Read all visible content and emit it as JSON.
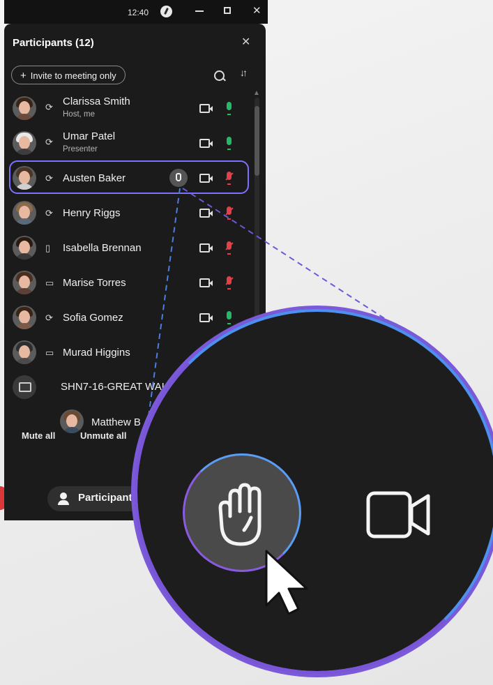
{
  "titlebar": {
    "time": "12:40"
  },
  "panel": {
    "title": "Participants (12)",
    "invite_label": "Invite to meeting only",
    "participants": [
      {
        "name": "Clarissa Smith",
        "role": "Host, me",
        "device": "headset",
        "mic": "on",
        "hair": "#3a2418",
        "body": "#6a4a3a"
      },
      {
        "name": "Umar Patel",
        "role": "Presenter",
        "device": "headset",
        "mic": "on",
        "hair": "#e9e9e9",
        "body": "#3d3d3d"
      },
      {
        "name": "Austen Baker",
        "role": "",
        "device": "headset",
        "mic": "off",
        "hand_raised": true,
        "hair": "#4a3526",
        "body": "#cfcfcf"
      },
      {
        "name": "Henry Riggs",
        "role": "",
        "device": "headset",
        "mic": "off",
        "hair": "#8a6a4a",
        "body": "#5a6a7a"
      },
      {
        "name": "Isabella Brennan",
        "role": "",
        "device": "phone",
        "mic": "off",
        "hair": "#2a1a12",
        "body": "#3a3a3a"
      },
      {
        "name": "Marise Torres",
        "role": "",
        "device": "laptop",
        "mic": "off",
        "hair": "#4a2e1e",
        "body": "#5a4036"
      },
      {
        "name": "Sofia Gomez",
        "role": "",
        "device": "headset",
        "mic": "on",
        "hair": "#3a2418",
        "body": "#7a5a4a"
      },
      {
        "name": "Murad Higgins",
        "role": "",
        "device": "laptop",
        "mic": "",
        "hair": "#2e2e2e",
        "body": "#4b4b4b"
      }
    ],
    "device_room": "SHN7-16-GREAT WAL",
    "sub_participant": "Matthew B",
    "mute_all": "Mute all",
    "unmute_all": "Unmute all"
  },
  "bottombar": {
    "participants_label": "Participants"
  },
  "colors": {
    "accent_blue": "#4f8ff0",
    "accent_purple": "#7b54d9",
    "mic_on": "#25b868",
    "mic_off": "#e2404a"
  },
  "icons": {
    "zoom_hand": "raise-hand-icon",
    "zoom_camera": "video-camera-icon",
    "cursor": "pointer-cursor-icon"
  }
}
